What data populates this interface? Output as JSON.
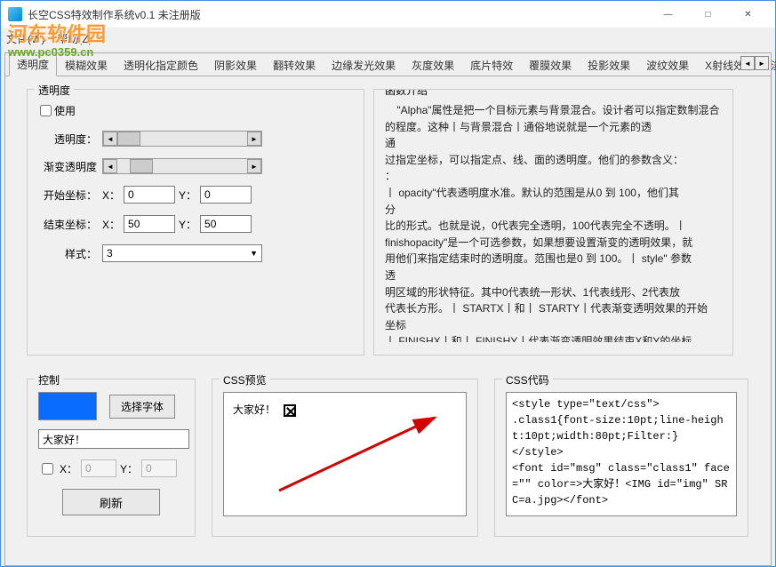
{
  "window": {
    "title": "长空CSS特效制作系统v0.1 未注册版",
    "min": "—",
    "max": "□",
    "close": "✕"
  },
  "watermark": {
    "line1": "河东软件园",
    "line2": "www.pc0359.cn"
  },
  "menu": {
    "file": "文件(W)",
    "help": "帮助(Z)"
  },
  "tabs": {
    "items": [
      "透明度",
      "模糊效果",
      "透明化指定颜色",
      "阴影效果",
      "翻转效果",
      "边缘发光效果",
      "灰度效果",
      "底片特效",
      "覆膜效果",
      "投影效果",
      "波纹效果",
      "X射线效果",
      "淡入淡"
    ],
    "nav_left": "◄",
    "nav_right": "►"
  },
  "panel_opacity": {
    "title": "透明度",
    "use": "使用",
    "row_opacity": "透明度：",
    "row_grad": "渐变透明度",
    "row_start": "开始坐标：",
    "row_end": "结束坐标：",
    "row_style": "样式：",
    "x": "X：",
    "y": "Y：",
    "start_x": "0",
    "start_y": "0",
    "end_x": "50",
    "end_y": "50",
    "style_value": "3",
    "sb_left": "◄",
    "sb_right": "►"
  },
  "panel_desc": {
    "title": "函数介绍",
    "text": "    \"Alpha\"属性是把一个目标元素与背景混合。设计者可以指定数制混合的程度。这种丨与背景混合丨通俗地说就是一个元素的透\n通\n过指定坐标，可以指定点、线、面的透明度。他们的参数含义：\n：\n丨 opacity\"代表透明度水准。默认的范围是从0 到 100，他们其\n分\n比的形式。也就是说，0代表完全透明，100代表完全不透明。丨finishopacity\"是一个可选参数，如果想要设置渐变的透明效果，就\n用他们来指定结束时的透明度。范围也是0 到 100。丨 style\" 参数\n透\n明区域的形状特征。其中0代表统一形状、1代表线形、2代表放\n代表长方形。丨 STARTX丨和丨 STARTY丨代表渐变透明效果的开始\n坐标\n丨 FINISHX丨和丨 FINISHY丨代表渐变透明效果结束X和Y的坐标。"
  },
  "panel_ctrl": {
    "title": "控制",
    "choose_font": "选择字体",
    "text_value": "大家好！",
    "chk": "",
    "x": "X：",
    "y": "Y：",
    "x_val": "0",
    "y_val": "0",
    "refresh": "刷新",
    "swatch_color": "#0a6cff"
  },
  "panel_preview": {
    "title": "CSS预览",
    "sample": "大家好！"
  },
  "panel_code": {
    "title": "CSS代码",
    "text": "<style type=\"text/css\">\n.class1{font-size:10pt;line-height:10pt;width:80pt;Filter:}\n</style>\n<font id=\"msg\" class=\"class1\" face=\"\" color=>大家好！<IMG id=\"img\" SRC=a.jpg></font>"
  }
}
